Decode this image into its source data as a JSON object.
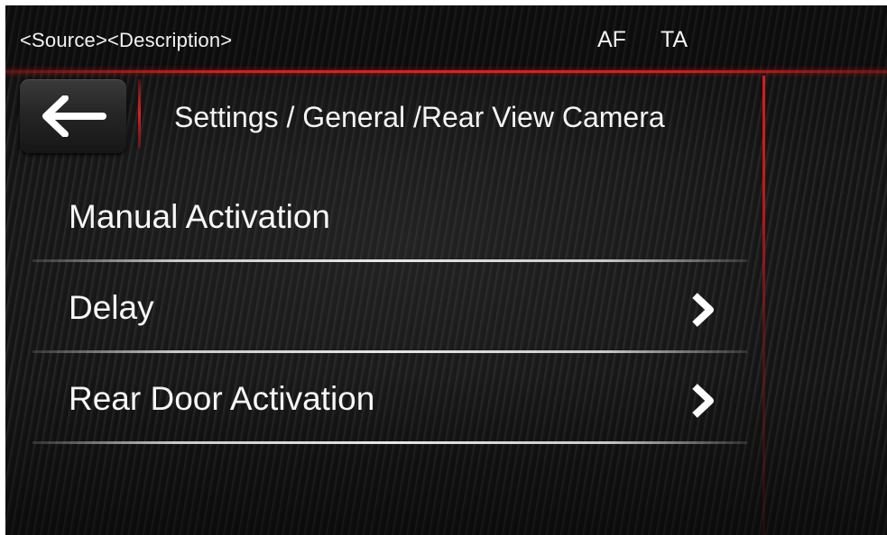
{
  "status_bar": {
    "source_description": "<Source><Description>",
    "af": "AF",
    "ta": "TA"
  },
  "header": {
    "back_icon": "arrow-left-icon",
    "breadcrumb": "Settings / General /Rear View Camera"
  },
  "menu": {
    "items": [
      {
        "label": "Manual Activation",
        "has_chevron": false
      },
      {
        "label": "Delay",
        "has_chevron": true,
        "icon": "chevron-right-icon"
      },
      {
        "label": "Rear Door Activation",
        "has_chevron": true,
        "icon": "chevron-right-icon"
      }
    ]
  },
  "colors": {
    "accent_red": "#e01f1f",
    "text": "#ffffff",
    "separator": "#e6e6e6"
  }
}
